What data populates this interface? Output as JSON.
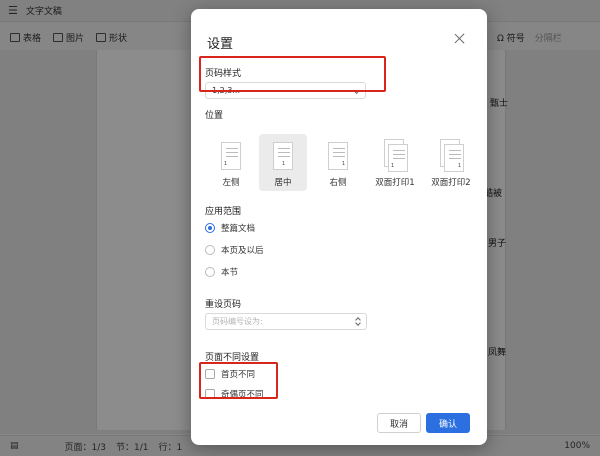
{
  "app": {
    "doc_title": "文字文稿",
    "toolbar": {
      "table": "表格",
      "picture": "图片",
      "shape": "形状",
      "symbol": "符号",
      "columns": "分隔栏"
    },
    "background_text": [
      "甄士",
      "酷被",
      "男子",
      "凤舞"
    ],
    "status": {
      "page": "页面：1/3",
      "section": "节：1/1",
      "line": "行：1",
      "zoom": "100%"
    }
  },
  "dialog": {
    "title": "设置",
    "page_style": {
      "label": "页码样式",
      "value": "1,2,3..."
    },
    "position": {
      "label": "位置",
      "options": [
        {
          "label": "左侧",
          "selected": false
        },
        {
          "label": "居中",
          "selected": true
        },
        {
          "label": "右侧",
          "selected": false
        },
        {
          "label": "双面打印1",
          "selected": false
        },
        {
          "label": "双面打印2",
          "selected": false
        }
      ]
    },
    "apply_scope": {
      "label": "应用范围",
      "options": [
        {
          "label": "整篇文档",
          "checked": true
        },
        {
          "label": "本页及以后",
          "checked": false
        },
        {
          "label": "本节",
          "checked": false
        }
      ]
    },
    "reset": {
      "label": "重设页码",
      "placeholder": "页码编号设为:"
    },
    "page_diff": {
      "label": "页面不同设置",
      "options": [
        {
          "label": "首页不同",
          "checked": false
        },
        {
          "label": "奇偶页不同",
          "checked": false
        }
      ]
    },
    "buttons": {
      "cancel": "取消",
      "ok": "确认"
    },
    "accent_color": "#2b6fe0",
    "highlight_color": "#d9261c"
  }
}
